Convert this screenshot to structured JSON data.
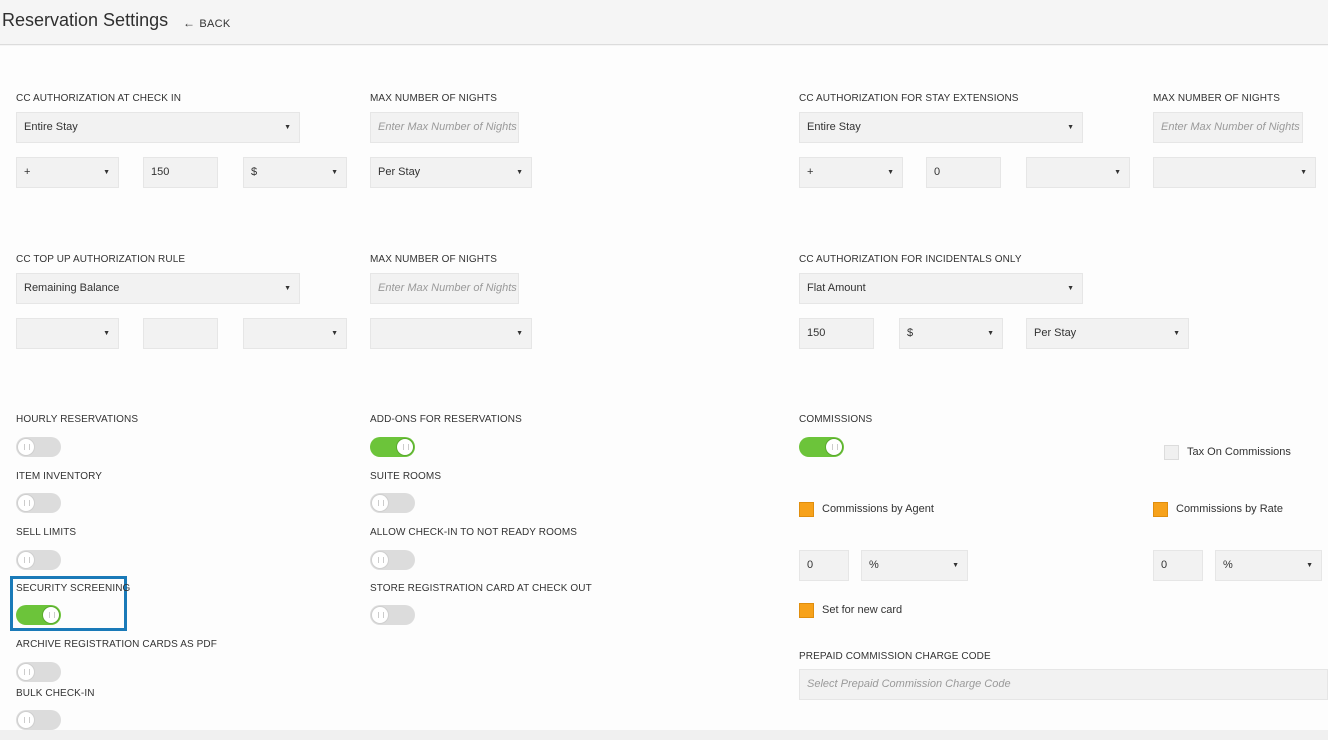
{
  "header": {
    "title": "Reservation Settings",
    "back_label": "BACK"
  },
  "section1": {
    "cc_auth_checkin_label": "CC AUTHORIZATION AT CHECK IN",
    "cc_auth_checkin_value": "Entire Stay",
    "operator_value": "+",
    "amount_value": "150",
    "currency_value": "$",
    "max_nights_label": "MAX NUMBER OF NIGHTS",
    "max_nights_placeholder": "Enter Max Number of Nights",
    "per_value": "Per Stay"
  },
  "section2": {
    "cc_auth_ext_label": "CC AUTHORIZATION FOR STAY EXTENSIONS",
    "cc_auth_ext_value": "Entire Stay",
    "operator_value": "+",
    "amount_value": "0",
    "currency_value": "",
    "max_nights_label": "MAX NUMBER OF NIGHTS",
    "max_nights_placeholder": "Enter Max Number of Nights",
    "per_value": ""
  },
  "section3": {
    "topup_label": "CC TOP UP AUTHORIZATION RULE",
    "topup_value": "Remaining Balance",
    "operator_value": "",
    "amount_value": "",
    "currency_value": "",
    "max_nights_label": "MAX NUMBER OF NIGHTS",
    "max_nights_placeholder": "Enter Max Number of Nights",
    "per_value": ""
  },
  "section4": {
    "incidentals_label": "CC AUTHORIZATION FOR INCIDENTALS ONLY",
    "incidentals_value": "Flat Amount",
    "amount_value": "150",
    "currency_value": "$",
    "per_value": "Per Stay"
  },
  "toggles": {
    "hourly": {
      "label": "HOURLY RESERVATIONS",
      "on": false
    },
    "item_inventory": {
      "label": "ITEM INVENTORY",
      "on": false
    },
    "sell_limits": {
      "label": "SELL LIMITS",
      "on": false
    },
    "security_screening": {
      "label": "SECURITY SCREENING",
      "on": true
    },
    "archive_cards": {
      "label": "ARCHIVE REGISTRATION CARDS AS PDF",
      "on": false
    },
    "bulk_checkin": {
      "label": "BULK CHECK-IN",
      "on": false
    },
    "addons": {
      "label": "ADD-ONS FOR RESERVATIONS",
      "on": true
    },
    "suite_rooms": {
      "label": "SUITE ROOMS",
      "on": false
    },
    "checkin_not_ready": {
      "label": "ALLOW CHECK-IN TO NOT READY ROOMS",
      "on": false
    },
    "store_reg_card": {
      "label": "STORE REGISTRATION CARD AT CHECK OUT",
      "on": false
    },
    "commissions": {
      "label": "COMMISSIONS",
      "on": true
    }
  },
  "commissions": {
    "tax_on_commissions": "Tax On Commissions",
    "by_agent": "Commissions by Agent",
    "agent_value": "0",
    "agent_unit": "%",
    "by_rate": "Commissions by Rate",
    "rate_value": "0",
    "rate_unit": "%",
    "set_new_card": "Set for new card",
    "prepaid_label": "PREPAID COMMISSION CHARGE CODE",
    "prepaid_placeholder": "Select Prepaid Commission Charge Code"
  },
  "icons": {
    "caret": "▼",
    "back_arrow": "🠔"
  },
  "colors": {
    "toggle_on": "#6cc43a",
    "toggle_off": "#dcdcdc",
    "checkbox_orange": "#f7a21b",
    "highlight": "#1a7ab8"
  }
}
